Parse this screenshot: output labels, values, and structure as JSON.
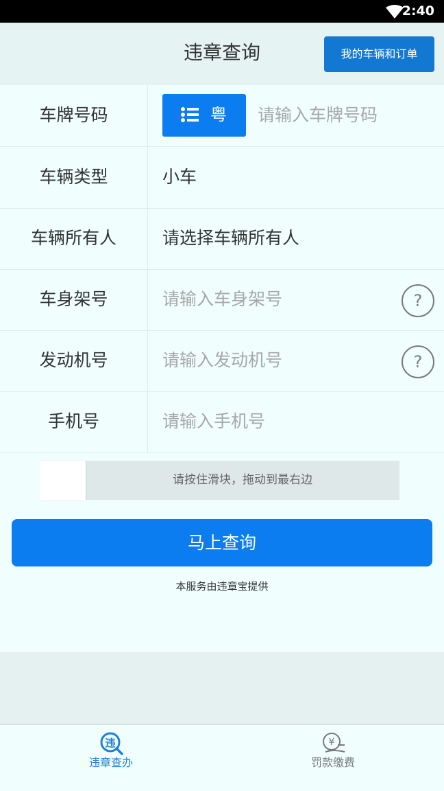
{
  "status_bar": {
    "time": "2:40"
  },
  "header": {
    "title": "违章查询",
    "orders_button": "我的车辆和订单"
  },
  "form": {
    "plate": {
      "label": "车牌号码",
      "province": "粤",
      "placeholder": "请输入车牌号码"
    },
    "vehicle_type": {
      "label": "车辆类型",
      "value": "小车"
    },
    "owner": {
      "label": "车辆所有人",
      "value": "请选择车辆所有人"
    },
    "vin": {
      "label": "车身架号",
      "placeholder": "请输入车身架号",
      "help": "?"
    },
    "engine": {
      "label": "发动机号",
      "placeholder": "请输入发动机号",
      "help": "?"
    },
    "phone": {
      "label": "手机号",
      "placeholder": "请输入手机号"
    }
  },
  "slider": {
    "text": "请按住滑块，拖动到最右边"
  },
  "query_button": "马上查询",
  "service_note": "本服务由违章宝提供",
  "tabs": [
    {
      "label": "违章查办",
      "icon": "violation-search-icon",
      "active": true
    },
    {
      "label": "罚款缴费",
      "icon": "fine-payment-icon",
      "active": false
    }
  ],
  "colors": {
    "accent": "#0b7df0",
    "header_button": "#1378d2",
    "tab_active": "#1f7ed8",
    "tab_inactive": "#7a7a7a"
  }
}
